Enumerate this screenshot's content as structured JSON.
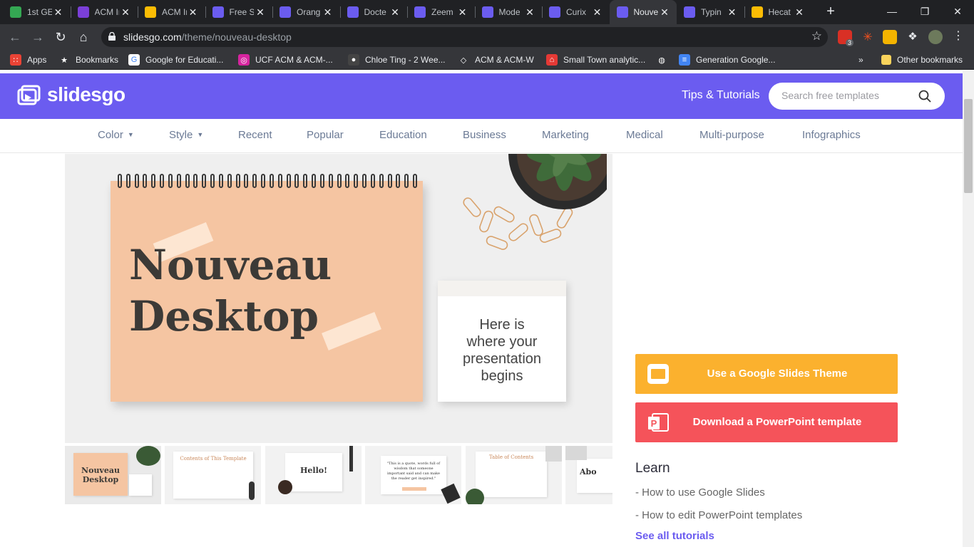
{
  "browser": {
    "tabs": [
      {
        "title": "1st GE",
        "color": "#34a853"
      },
      {
        "title": "ACM Ir",
        "color": "#7b3fd8"
      },
      {
        "title": "ACM Ir",
        "color": "#fbbc04"
      },
      {
        "title": "Free Sl",
        "color": "#6b5cf0"
      },
      {
        "title": "Orang",
        "color": "#6b5cf0"
      },
      {
        "title": "Docte",
        "color": "#6b5cf0"
      },
      {
        "title": "Zeem",
        "color": "#6b5cf0"
      },
      {
        "title": "Mode",
        "color": "#6b5cf0"
      },
      {
        "title": "Curix",
        "color": "#6b5cf0"
      },
      {
        "title": "Nouve",
        "color": "#6b5cf0"
      },
      {
        "title": "Typin",
        "color": "#6b5cf0"
      },
      {
        "title": "Hecat",
        "color": "#fbbc04"
      }
    ],
    "active_tab_index": 9,
    "url_host": "slidesgo.com",
    "url_path": "/theme/nouveau-desktop",
    "extension_badge": "3",
    "bookmarks": [
      {
        "label": "Apps",
        "icon": "apps-grid-icon"
      },
      {
        "label": "Bookmarks",
        "icon": "star-icon"
      },
      {
        "label": "Google for Educati...",
        "icon": "google-icon"
      },
      {
        "label": "UCF ACM & ACM-...",
        "icon": "instagram-icon"
      },
      {
        "label": "Chloe Ting - 2 Wee...",
        "icon": "person-icon"
      },
      {
        "label": "ACM & ACM-W",
        "icon": "diamond-icon"
      },
      {
        "label": "Small Town analytic...",
        "icon": "store-icon"
      },
      {
        "label": "",
        "icon": "globe-icon"
      },
      {
        "label": "Generation Google...",
        "icon": "doc-icon"
      }
    ],
    "overflow_label": "»",
    "other_bookmarks": "Other bookmarks"
  },
  "site": {
    "logo_text": "slidesgo",
    "tips_label": "Tips & Tutorials",
    "search_placeholder": "Search free templates",
    "nav": [
      {
        "label": "Color",
        "dropdown": true
      },
      {
        "label": "Style",
        "dropdown": true
      },
      {
        "label": "Recent",
        "dropdown": false
      },
      {
        "label": "Popular",
        "dropdown": false
      },
      {
        "label": "Education",
        "dropdown": false
      },
      {
        "label": "Business",
        "dropdown": false
      },
      {
        "label": "Marketing",
        "dropdown": false
      },
      {
        "label": "Medical",
        "dropdown": false
      },
      {
        "label": "Multi-purpose",
        "dropdown": false
      },
      {
        "label": "Infographics",
        "dropdown": false
      }
    ],
    "preview": {
      "title_line1": "Nouveau",
      "title_line2": "Desktop",
      "card_lines": [
        "Here is",
        "where your",
        "presentation",
        "begins"
      ]
    },
    "thumbnails": [
      {
        "title": "Nouveau Desktop"
      },
      {
        "title": "Contents of This Template"
      },
      {
        "title": "Hello!"
      },
      {
        "title": "\"This is a quote, words full of wisdom that someone important said and can make the reader get inspired.\""
      },
      {
        "title": "Table of Contents"
      },
      {
        "title": "Abo"
      }
    ],
    "google_btn": "Use a Google Slides Theme",
    "ppt_btn": "Download a PowerPoint template",
    "learn_title": "Learn",
    "learn_links": [
      "- How to use Google Slides",
      "- How to edit PowerPoint templates"
    ],
    "see_all": "See all tutorials",
    "colors": {
      "brand": "#6b5cf0",
      "google_yellow": "#fbb12e",
      "ppt_red": "#f5535a"
    }
  }
}
